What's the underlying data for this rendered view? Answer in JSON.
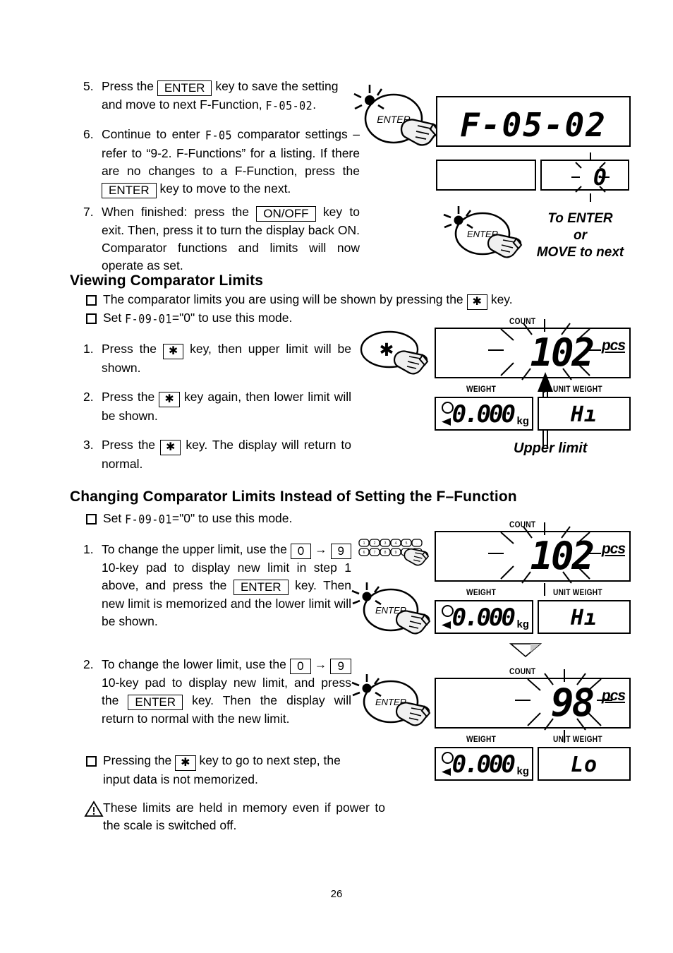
{
  "steps_top": [
    {
      "num": "5.",
      "parts": [
        "Press the ",
        "ENTER",
        " key to save the setting and move to next F-Function, ",
        "F-05-02",
        "."
      ]
    },
    {
      "num": "6.",
      "parts": [
        "Continue to enter ",
        "F-05",
        " comparator settings – refer to “9-2. F-Functions” for a listing. If there are no changes to a F-Function, press the ",
        "ENTER",
        " key to move to the next."
      ]
    },
    {
      "num": "7.",
      "parts": [
        "When finished: press the ",
        "ON/OFF",
        " key to exit. Then, press it to turn the display back ON. Comparator functions and limits will now operate as set."
      ]
    }
  ],
  "step5": {
    "t1": "Press the",
    "key": "ENTER",
    "t2": "key to save the setting and move to next F-Function,",
    "seg": "F-05-02",
    "t3": "."
  },
  "step6": {
    "t1": "Continue to enter",
    "seg": "F-05",
    "t2": "comparator settings – refer to “9-2. F-Functions” for a listing. If there are no changes to a F-Function, press the",
    "key": "ENTER",
    "t3": "key to move to the next."
  },
  "step7": {
    "t1": "When finished: press the",
    "key": "ON/OFF",
    "t2": "key to exit. Then, press it to turn the display back ON. Comparator functions and limits will now operate as set."
  },
  "enter_icon_label": "ENTER",
  "star_icon_label": "✱",
  "to_enter_block": {
    "line1": "To ENTER",
    "line2": "or",
    "line3": "MOVE to next"
  },
  "display_top": {
    "main": "F-05-02",
    "left_box": "",
    "right_box": "0"
  },
  "section_viewing": {
    "heading": "Viewing Comparator Limits",
    "bullet1_a": "The comparator limits you are using will be shown by pressing the",
    "bullet1_key": "✱",
    "bullet1_b": "key.",
    "bullet2_a": "Set",
    "bullet2_seg": "F-09-01",
    "bullet2_b": "=\"0\" to use this mode.",
    "steps": [
      {
        "num": "1.",
        "a": "Press the",
        "key": "✱",
        "b": "key, then upper limit will be shown."
      },
      {
        "num": "2.",
        "a": "Press the",
        "key": "✱",
        "b": "key again, then lower limit will be shown."
      },
      {
        "num": "3.",
        "a": "Press the",
        "key": "✱",
        "b": "key. The display will return to normal."
      }
    ],
    "caption": "Upper limit"
  },
  "section_changing": {
    "heading": "Changing Comparator Limits Instead of Setting the F–Function",
    "bullet1_a": "Set",
    "bullet1_seg": "F-09-01",
    "bullet1_b": "=\"0\" to use this mode.",
    "step1": {
      "num": "1.",
      "a": "To change the upper limit, use the",
      "key0": "0",
      "arrow": "→",
      "key9": "9",
      "b": "10-key pad to display new limit in step 1 above, and press the",
      "keyEnter": "ENTER",
      "c": "key. Then new limit is memorized and the lower limit will be shown."
    },
    "step2": {
      "num": "2.",
      "a": "To change the lower limit, use the",
      "key0": "0",
      "arrow": "→",
      "key9": "9",
      "b": "10-key pad to display new limit, and press the",
      "keyEnter": "ENTER",
      "c": "key. Then the display will return to normal with the new limit."
    },
    "bullet2_a": "Pressing the",
    "bullet2_key": "✱",
    "bullet2_b": "key to go to next step, the input data is not memorized.",
    "warning": "These limits are held in memory even if power to the scale is switched off."
  },
  "lcd_labels": {
    "count": "COUNT",
    "weight": "WEIGHT",
    "unit_weight": "UNIT  WEIGHT",
    "pcs": "pcs",
    "kg": "kg"
  },
  "displays": {
    "viewing": {
      "count": "102",
      "weight": "0.000",
      "unit": "Hı"
    },
    "changing_upper": {
      "count": "102",
      "weight": "0.000",
      "unit": "Hı"
    },
    "changing_lower": {
      "count": "98",
      "weight": "0.000",
      "unit": "Lo"
    }
  },
  "page_number": "26",
  "colors": {
    "ink": "#000000",
    "paper": "#ffffff",
    "hand_fill": "#f2f2f2"
  }
}
